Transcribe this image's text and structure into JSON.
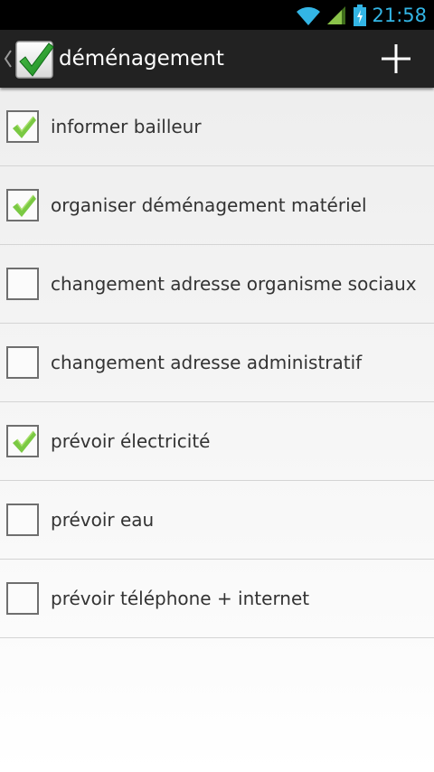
{
  "status_bar": {
    "time": "21:58",
    "accent_color": "#33b5e5",
    "icons": [
      "wifi-icon",
      "signal-icon",
      "battery-charging-icon"
    ]
  },
  "action_bar": {
    "title": "déménagement",
    "up_icon": "chevron-left-icon",
    "logo_icon": "checkmark-logo-icon",
    "action_icon": "plus-icon"
  },
  "tasks": [
    {
      "label": "informer bailleur",
      "checked": true
    },
    {
      "label": "organiser déménagement matériel",
      "checked": true
    },
    {
      "label": "changement adresse organisme sociaux",
      "checked": false
    },
    {
      "label": "changement adresse administratif",
      "checked": false
    },
    {
      "label": "prévoir électricité",
      "checked": true
    },
    {
      "label": "prévoir eau",
      "checked": false
    },
    {
      "label": "prévoir téléphone + internet",
      "checked": false
    }
  ],
  "colors": {
    "check_green": "#7ac943",
    "checkbox_border": "#6f6f6f",
    "text": "#333333"
  }
}
